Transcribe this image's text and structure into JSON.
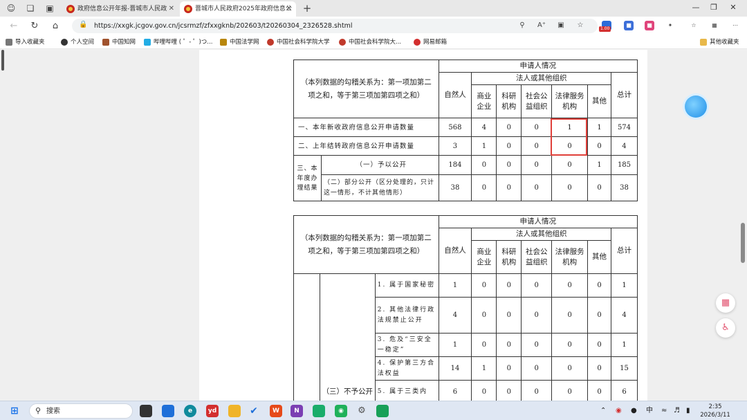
{
  "browser": {
    "tabs": [
      {
        "title": "政府信息公开年报-晋城市人民政",
        "active": false
      },
      {
        "title": "晋城市人民政府2025年政府信息公",
        "active": true
      }
    ],
    "url": "https://xxgk.jcgov.gov.cn/jcsrmzf/zfxxgknb/202603/t20260304_2326528.shtml",
    "extension_badge": "1.00",
    "bookmarks": [
      {
        "label": "导入收藏夹",
        "color": "#555555"
      },
      {
        "label": "个人空间",
        "color": "#333333"
      },
      {
        "label": "中国知网",
        "color": "#a0522d"
      },
      {
        "label": "哔哩哔哩 ( ゜- ゜)つ...",
        "color": "#23ade5"
      },
      {
        "label": "中国法学网",
        "color": "#b8860b"
      },
      {
        "label": "中国社会科学院大学",
        "color": "#c0392b"
      },
      {
        "label": "中国社会科学院大...",
        "color": "#c0392b"
      },
      {
        "label": "网易邮箱",
        "color": "#d32f2f"
      }
    ],
    "other_bookmarks": "其他收藏夹"
  },
  "table1": {
    "header_left": "（本列数据的勾稽关系为：第一项加第二项之和，等于第三项加第四项之和）",
    "applicant_title": "申请人情况",
    "org_title": "法人或其他组织",
    "col_natural": "自然人",
    "col_business": "商业企业",
    "col_research": "科研机构",
    "col_social": "社会公益组织",
    "col_legal": "法律服务机构",
    "col_other": "其他",
    "col_total": "总计",
    "rows": [
      {
        "label": "一、本年新收政府信息公开申请数量",
        "values": [
          "568",
          "4",
          "0",
          "0",
          "1",
          "1",
          "574"
        ]
      },
      {
        "label": "二、上年结转政府信息公开申请数量",
        "values": [
          "3",
          "1",
          "0",
          "0",
          "0",
          "0",
          "4"
        ]
      }
    ],
    "section3_label": "三、本年度办理结果",
    "result_rows": [
      {
        "label": "（一）予以公开",
        "values": [
          "184",
          "0",
          "0",
          "0",
          "0",
          "1",
          "185"
        ]
      },
      {
        "label": "（二）部分公开（区分处理的，只计这一情形，不计其他情形）",
        "values": [
          "38",
          "0",
          "0",
          "0",
          "0",
          "0",
          "38"
        ]
      }
    ]
  },
  "table2": {
    "header_left": "（本列数据的勾稽关系为：第一项加第二项之和，等于第三项加第四项之和）",
    "applicant_title": "申请人情况",
    "org_title": "法人或其他组织",
    "col_natural": "自然人",
    "col_business": "商业企业",
    "col_research": "科研机构",
    "col_social": "社会公益组织",
    "col_legal": "法律服务机构",
    "col_other": "其他",
    "col_total": "总计",
    "group_label": "（三）不予公开",
    "rows": [
      {
        "label": "1. 属于国家秘密",
        "values": [
          "1",
          "0",
          "0",
          "0",
          "0",
          "0",
          "1"
        ]
      },
      {
        "label": "2. 其他法律行政法规禁止公开",
        "values": [
          "4",
          "0",
          "0",
          "0",
          "0",
          "0",
          "4"
        ]
      },
      {
        "label": "3. 危及“三安全一稳定”",
        "values": [
          "1",
          "0",
          "0",
          "0",
          "0",
          "0",
          "1"
        ]
      },
      {
        "label": "4. 保护第三方合法权益",
        "values": [
          "14",
          "1",
          "0",
          "0",
          "0",
          "0",
          "15"
        ]
      },
      {
        "label": "5. 属于三类内",
        "values": [
          "6",
          "0",
          "0",
          "0",
          "0",
          "0",
          "6"
        ]
      }
    ]
  },
  "taskbar": {
    "search_placeholder": "搜索",
    "ime": "中",
    "time": "2:35",
    "date": "2026/3/11"
  }
}
